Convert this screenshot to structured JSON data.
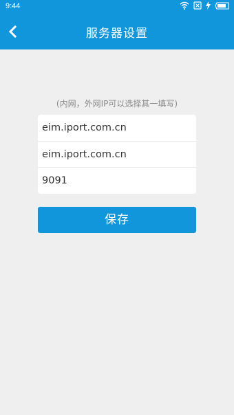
{
  "status_bar": {
    "time": "9:44",
    "icons": [
      "wifi-icon",
      "sim-blocked-icon",
      "charging-icon",
      "battery-icon"
    ]
  },
  "header": {
    "title": "服务器设置",
    "back_icon": "chevron-left-icon"
  },
  "form": {
    "hint": "(内网，外网IP可以选择其一填写)",
    "intranet_address": "eim.iport.com.cn",
    "extranet_address": "eim.iport.com.cn",
    "port": "9091"
  },
  "actions": {
    "save_label": "保存"
  },
  "colors": {
    "primary": "#1296db",
    "background": "#efeff0",
    "card": "#ffffff",
    "hint_text": "#8a8a8a",
    "field_text": "#333333"
  }
}
